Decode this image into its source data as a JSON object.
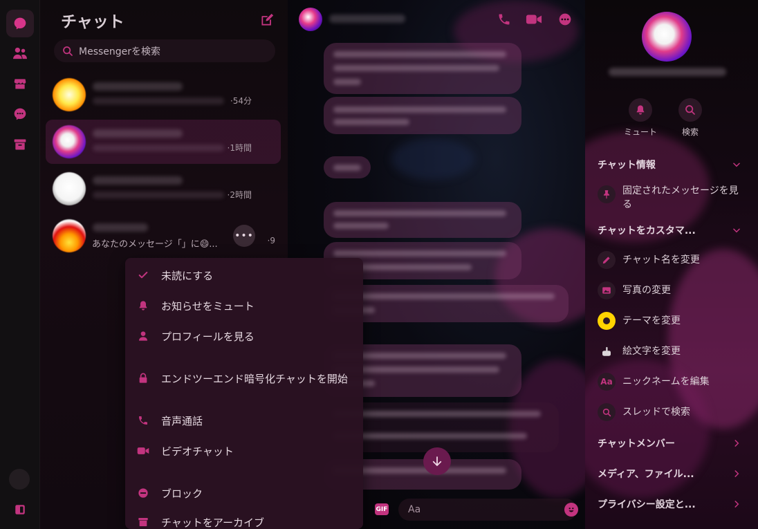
{
  "colors": {
    "accent": "#c2347f",
    "panel_bg": "#2a1222",
    "text": "#e6d9e1"
  },
  "chatlist": {
    "title": "チャット",
    "search_placeholder": "Messengerを検索",
    "conversations": [
      {
        "time": "·54分"
      },
      {
        "time": "·1時間"
      },
      {
        "time": "·2時間"
      },
      {
        "preview": "あなたのメッセージ「」に😄...",
        "time": "·9"
      }
    ]
  },
  "context_menu": {
    "items": [
      {
        "label": "未読にする",
        "icon": "check-icon"
      },
      {
        "label": "お知らせをミュート",
        "icon": "bell-icon"
      },
      {
        "label": "プロフィールを見る",
        "icon": "person-icon"
      },
      {
        "label": "エンドツーエンド暗号化チャットを開始",
        "icon": "lock-icon"
      },
      {
        "label": "音声通話",
        "icon": "phone-icon"
      },
      {
        "label": "ビデオチャット",
        "icon": "video-icon"
      },
      {
        "label": "ブロック",
        "icon": "block-icon"
      },
      {
        "label": "チャットをアーカイブ",
        "icon": "archive-icon"
      }
    ]
  },
  "composer": {
    "gif_label": "GIF",
    "placeholder": "Aa"
  },
  "info_panel": {
    "actions": [
      {
        "label": "ミュート",
        "icon": "bell-icon"
      },
      {
        "label": "検索",
        "icon": "search-icon"
      }
    ],
    "sections": {
      "chat_info": "チャット情報",
      "customize": "チャットをカスタマ...",
      "members": "チャットメンバー",
      "media": "メディア、ファイル...",
      "privacy": "プライバシー設定と..."
    },
    "rows": {
      "pinned": "固定されたメッセージを見る",
      "rename": "チャット名を変更",
      "photo": "写真の変更",
      "theme": "テーマを変更",
      "emoji": "絵文字を変更",
      "nickname": "ニックネームを編集",
      "search_thread": "スレッドで検索"
    },
    "nickname_icon_text": "Aa"
  }
}
